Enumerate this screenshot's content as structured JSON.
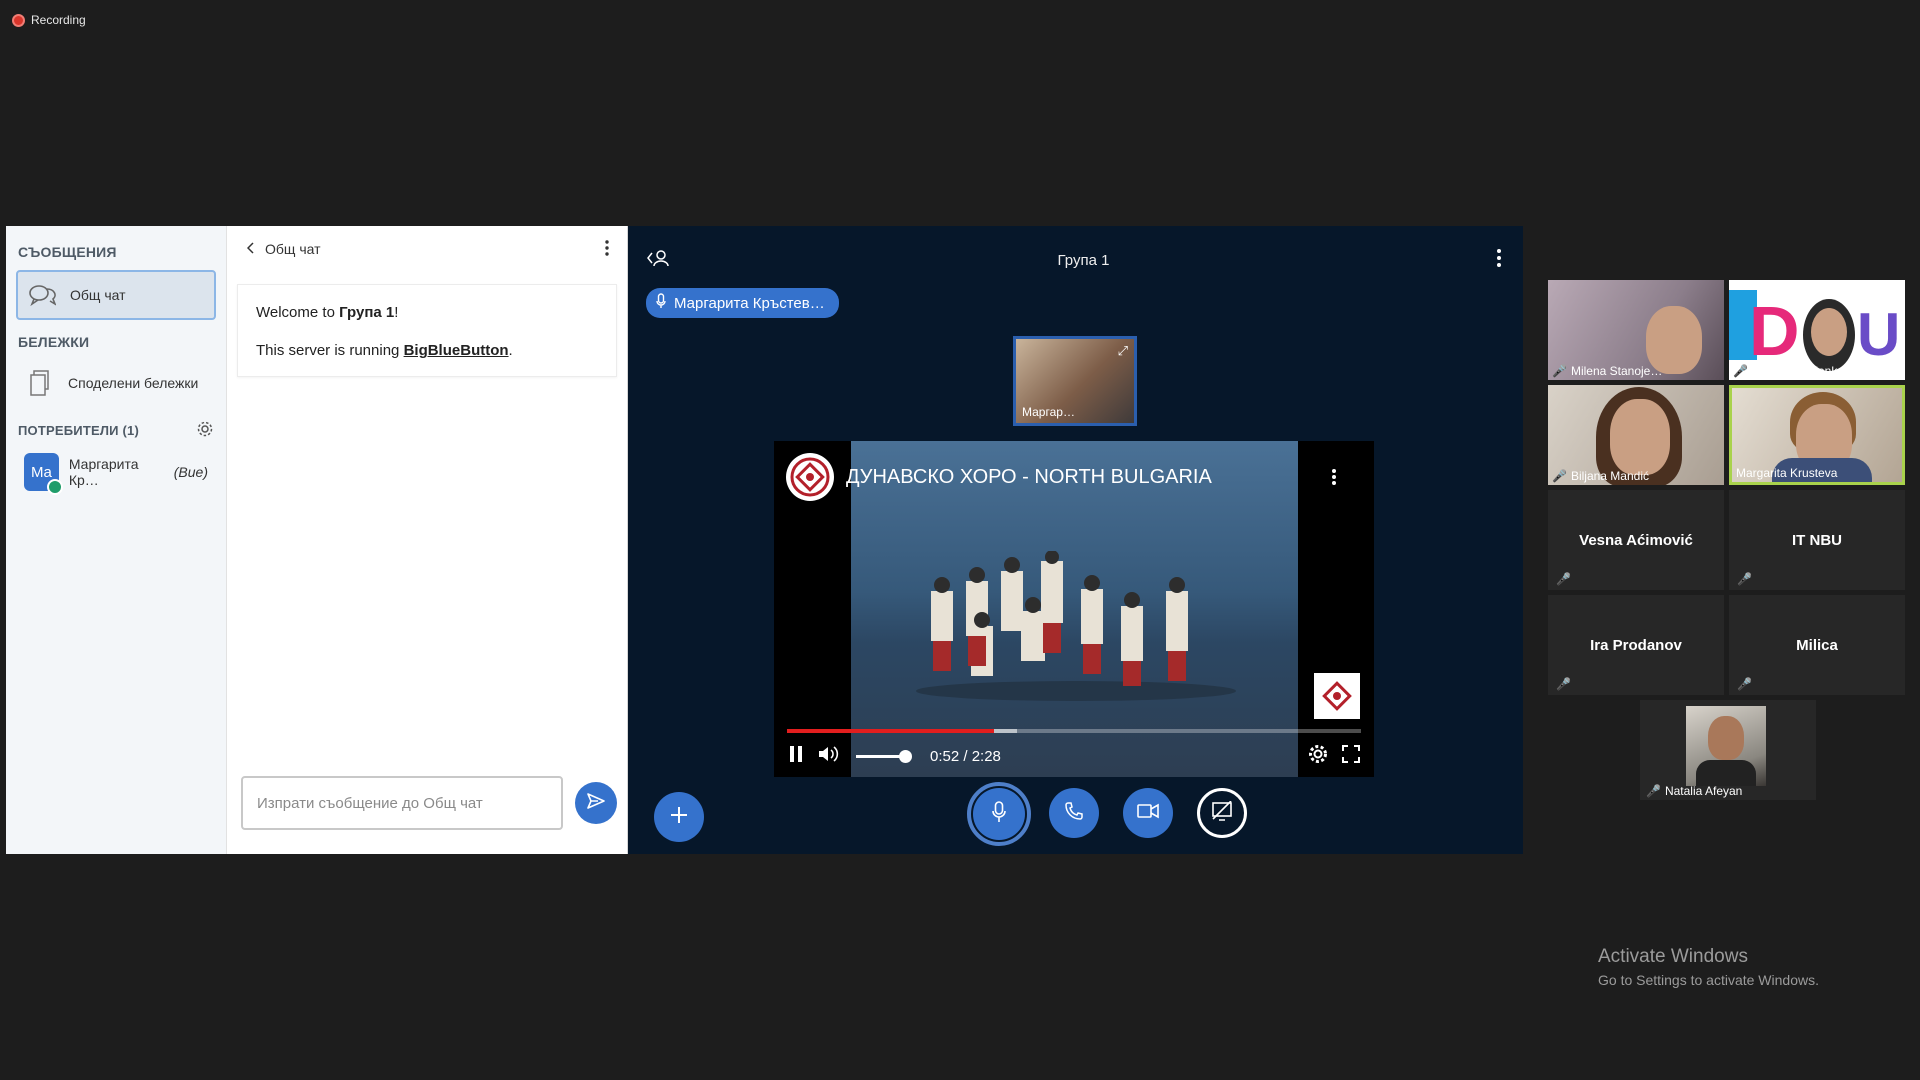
{
  "recording": {
    "label": "Recording"
  },
  "nav": {
    "messages_heading": "СЪОБЩЕНИЯ",
    "public_chat": "Общ чат",
    "notes_heading": "БЕЛЕЖКИ",
    "shared_notes": "Споделени бележки",
    "users_heading": "ПОТРЕБИТЕЛИ (1)",
    "user": {
      "initials": "Ma",
      "name": "Маргарита Кр…",
      "you": "(Вие)"
    }
  },
  "chat": {
    "title": "Общ чат",
    "welcome_prefix": "Welcome to ",
    "welcome_group": "Група 1",
    "welcome_suffix": "!",
    "server_prefix": "This server is running ",
    "server_link": "BigBlueButton",
    "server_suffix": ".",
    "input_placeholder": "Изпрати съобщение до Общ чат"
  },
  "stage": {
    "title": "Група 1",
    "talking": "Маргарита Кръстев…",
    "mini_cam_name": "Маргар…",
    "video": {
      "title": "ДУНАВСКО ХОРО - NORTH BULGARIA",
      "time": "0:52 / 2:28",
      "progress": 0.36
    }
  },
  "gallery": {
    "tiles": [
      {
        "name": "Milena Stanoje…",
        "type": "video"
      },
      {
        "name": "Dušanka Jelenk…",
        "type": "video"
      },
      {
        "name": "Biljana Mandić",
        "type": "video"
      },
      {
        "name": "Margarita Krusteva",
        "type": "video",
        "active": true
      },
      {
        "name": "Vesna Aćimović",
        "type": "name"
      },
      {
        "name": "IT NBU",
        "type": "name"
      },
      {
        "name": "Ira Prodanov",
        "type": "name"
      },
      {
        "name": "Milica",
        "type": "name"
      },
      {
        "name": "Natalia Afeyan",
        "type": "video"
      }
    ]
  },
  "watermark": {
    "line1": "Activate Windows",
    "line2": "Go to Settings to activate Windows."
  },
  "colors": {
    "accent": "#3572cc",
    "stage_bg": "#06172a",
    "active_speaker": "#a9d24c",
    "recording": "#d9352b"
  }
}
